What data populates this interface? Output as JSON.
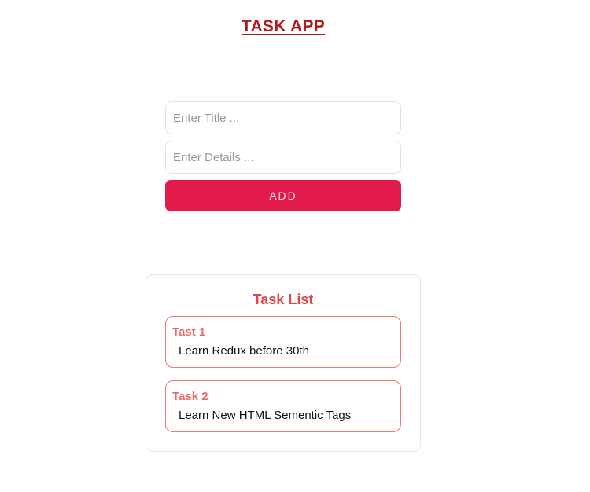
{
  "header": {
    "title": "TASK APP"
  },
  "form": {
    "title_placeholder": "Enter Title ...",
    "details_placeholder": "Enter Details ...",
    "title_value": "",
    "details_value": "",
    "add_label": "ADD"
  },
  "task_list": {
    "heading": "Task List",
    "items": [
      {
        "title": "Tast 1",
        "details": "Learn Redux before 30th"
      },
      {
        "title": "Task 2",
        "details": "Learn New HTML Sementic Tags"
      }
    ]
  },
  "colors": {
    "title_red": "#b3181f",
    "accent": "#e31b4b",
    "list_heading": "#e04848",
    "item_border": "#e87a7a"
  }
}
